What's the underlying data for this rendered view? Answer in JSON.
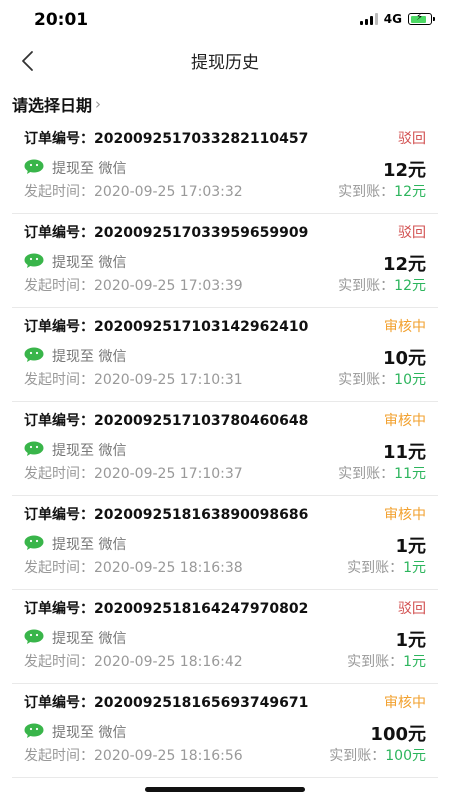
{
  "status_bar": {
    "time": "20:01",
    "network": "4G"
  },
  "nav": {
    "title": "提现历史"
  },
  "date_filter": {
    "label": "请选择日期",
    "chevron": "›"
  },
  "labels": {
    "order": "订单编号：",
    "withdraw_to": "提现至 微信",
    "start_time": "发起时间：",
    "received": "实到账："
  },
  "colors": {
    "reject": "#d25050",
    "review": "#f2a12f",
    "received": "#2db55d",
    "wechat": "#39b54a"
  },
  "records": [
    {
      "order_no": "202009251703328211045​7",
      "status": "驳回",
      "status_type": "reject",
      "amount": "12元",
      "time": "2020-09-25 17:03:32",
      "received": "12元"
    },
    {
      "order_no": "20200925170339596599​09",
      "status": "驳回",
      "status_type": "reject",
      "amount": "12元",
      "time": "2020-09-25 17:03:39",
      "received": "12元"
    },
    {
      "order_no": "20200925171031429624​10",
      "status": "审核中",
      "status_type": "review",
      "amount": "10元",
      "time": "2020-09-25 17:10:31",
      "received": "10元"
    },
    {
      "order_no": "20200925171037804606​48",
      "status": "审核中",
      "status_type": "review",
      "amount": "11元",
      "time": "2020-09-25 17:10:37",
      "received": "11元"
    },
    {
      "order_no": "20200925181638900986​86",
      "status": "审核中",
      "status_type": "review",
      "amount": "1元",
      "time": "2020-09-25 18:16:38",
      "received": "1元"
    },
    {
      "order_no": "20200925181642479708​02",
      "status": "驳回",
      "status_type": "reject",
      "amount": "1元",
      "time": "2020-09-25 18:16:42",
      "received": "1元"
    },
    {
      "order_no": "20200925181656937496​71",
      "status": "审核中",
      "status_type": "review",
      "amount": "100元",
      "time": "2020-09-25 18:16:56",
      "received": "100元"
    }
  ]
}
